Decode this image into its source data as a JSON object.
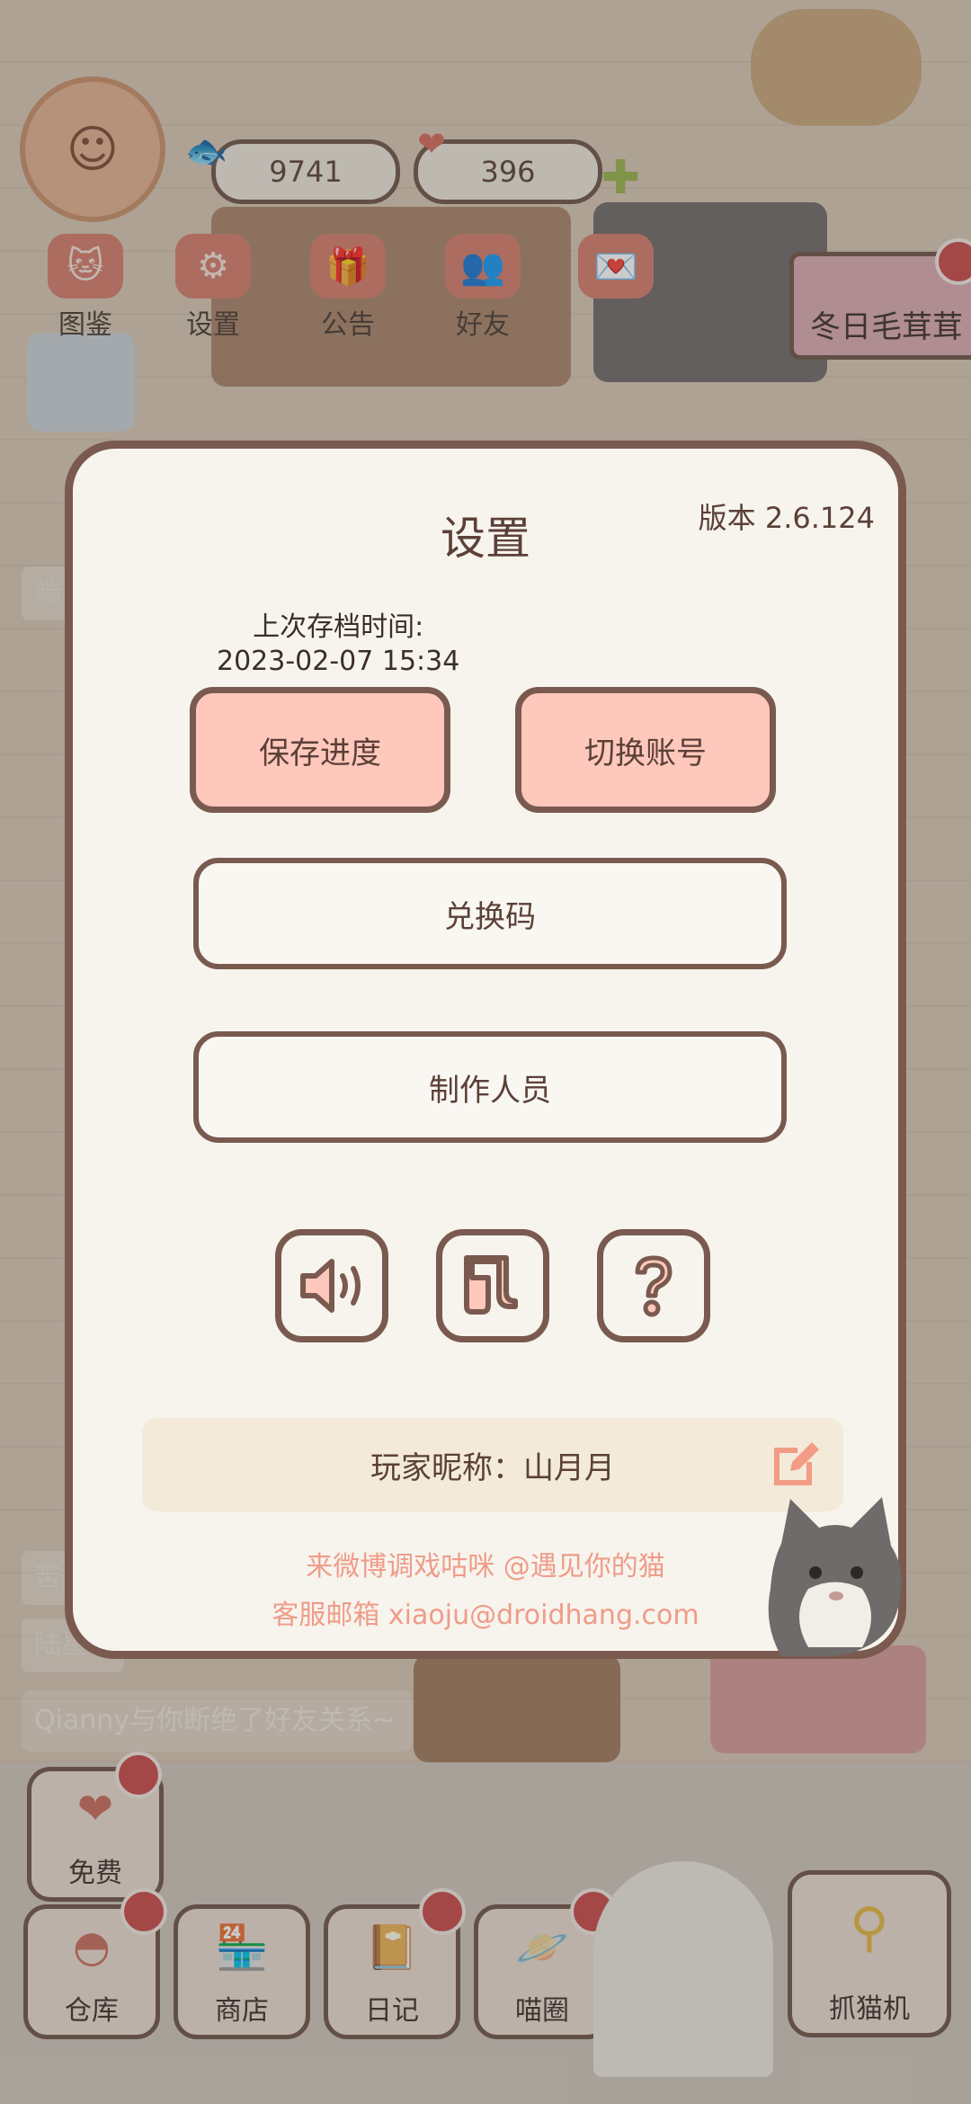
{
  "hud": {
    "coins": "9741",
    "hearts": "396",
    "nav": [
      {
        "label": "图鉴",
        "icon": "cat-face-icon"
      },
      {
        "label": "设置",
        "icon": "gear-icon"
      },
      {
        "label": "公告",
        "icon": "gift-icon"
      },
      {
        "label": "好友",
        "icon": "friends-icon"
      }
    ],
    "event_banner": "冬日毛茸茸"
  },
  "dialog": {
    "title": "设置",
    "version": "版本 2.6.124",
    "save_time_label": "上次存档时间:",
    "save_time_value": "2023-02-07 15:34",
    "save_button": "保存进度",
    "switch_button": "切换账号",
    "redeem_button": "兑换码",
    "credits_button": "制作人员",
    "icons": [
      "speaker-icon",
      "music-note-icon",
      "help-question-icon"
    ],
    "nickname_label": "玩家昵称：山月月",
    "footer_weibo": "来微博调戏咕咪 @遇见你的猫",
    "footer_email": "客服邮箱 xiaoju@droidhang.com"
  },
  "background": {
    "toast": "Qianny与你断绝了好友关系~",
    "side_chip_1": "苦",
    "side_chip_2": "陆星",
    "side_tab": "端"
  },
  "bottom": {
    "free": "免费",
    "warehouse": "仓库",
    "shop": "商店",
    "diary": "日记",
    "circle": "喵圈",
    "claw_machine": "抓猫机"
  },
  "colors": {
    "accent_pink": "#ffc8bc",
    "border_brown": "#7a5a4f",
    "panel": "#f7f4ee",
    "footer_text": "#ef9c88"
  }
}
